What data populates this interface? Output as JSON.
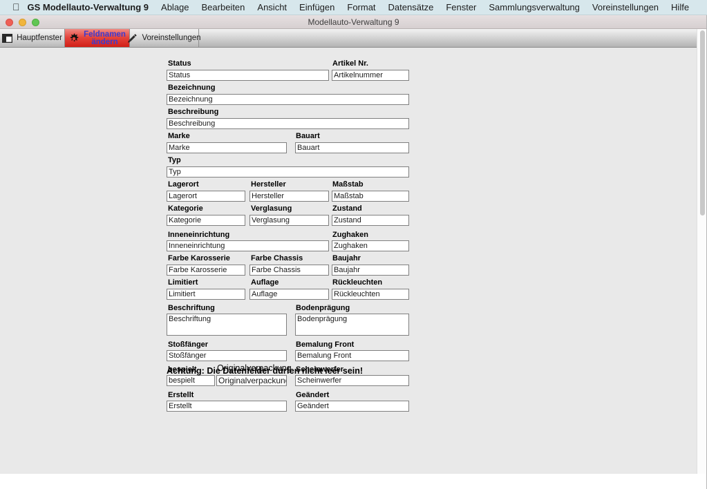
{
  "menubar": {
    "apple_icon": "apple-logo-icon",
    "app_name": "GS Modellauto-Verwaltung 9",
    "items": [
      {
        "label": "Ablage"
      },
      {
        "label": "Bearbeiten"
      },
      {
        "label": "Ansicht"
      },
      {
        "label": "Einfügen"
      },
      {
        "label": "Format"
      },
      {
        "label": "Datensätze"
      },
      {
        "label": "Fenster"
      },
      {
        "label": "Sammlungsverwaltung"
      },
      {
        "label": "Voreinstellungen"
      },
      {
        "label": "Hilfe"
      }
    ]
  },
  "window": {
    "title": "Modellauto-Verwaltung 9",
    "traffic_lights": {
      "close": "#ef5f56",
      "minimize": "#f1b53d",
      "zoom": "#61c654"
    }
  },
  "toolbar": {
    "tabs": [
      {
        "label": "Hauptfenster",
        "icon": "window-layout-icon",
        "active": false
      },
      {
        "label_line1": "Feldnamen",
        "label_line2": "ändern",
        "icon": "gear-icon",
        "active": true,
        "active_bg": "#e4443c",
        "active_text": "#3b3bcf"
      },
      {
        "label": "Voreinstellungen",
        "icon": "pencil-icon",
        "active": false
      }
    ]
  },
  "form": {
    "rows": [
      {
        "fields": [
          {
            "label": "Status",
            "value": "Status"
          },
          {
            "label": "Artikel Nr.",
            "value": "Artikelnummer"
          }
        ]
      },
      {
        "fields": [
          {
            "label": "Bezeichnung",
            "value": "Bezeichnung"
          }
        ]
      },
      {
        "fields": [
          {
            "label": "Beschreibung",
            "value": "Beschreibung"
          }
        ]
      },
      {
        "fields": [
          {
            "label": "Marke",
            "value": "Marke"
          },
          {
            "label": "Bauart",
            "value": "Bauart"
          }
        ]
      },
      {
        "fields": [
          {
            "label": "Typ",
            "value": "Typ"
          }
        ]
      },
      {
        "fields": [
          {
            "label": "Lagerort",
            "value": "Lagerort"
          },
          {
            "label": "Hersteller",
            "value": "Hersteller"
          },
          {
            "label": "Maßstab",
            "value": "Maßstab"
          }
        ]
      },
      {
        "fields": [
          {
            "label": "Kategorie",
            "value": "Kategorie"
          },
          {
            "label": "Verglasung",
            "value": "Verglasung"
          },
          {
            "label": "Zustand",
            "value": "Zustand"
          }
        ]
      },
      {
        "fields": [
          {
            "label": "Inneneinrichtung",
            "value": "Inneneinrichtung"
          },
          {
            "label": "Zughaken",
            "value": "Zughaken"
          }
        ]
      },
      {
        "fields": [
          {
            "label": "Farbe Karosserie",
            "value": "Farbe Karosserie"
          },
          {
            "label": "Farbe Chassis",
            "value": "Farbe Chassis"
          },
          {
            "label": "Baujahr",
            "value": "Baujahr"
          }
        ]
      },
      {
        "fields": [
          {
            "label": "Limitiert",
            "value": "Limitiert"
          },
          {
            "label": "Auflage",
            "value": "Auflage"
          },
          {
            "label": "Rückleuchten",
            "value": "Rückleuchten"
          }
        ]
      },
      {
        "fields": [
          {
            "label": "Beschriftung",
            "value": "Beschriftung"
          },
          {
            "label": "Bodenprägung",
            "value": "Bodenprägung"
          }
        ]
      },
      {
        "fields": [
          {
            "label": "Stoßfänger",
            "value": "Stoßfänger"
          },
          {
            "label": "Bemalung Front",
            "value": "Bemalung Front"
          }
        ]
      },
      {
        "fields": [
          {
            "label": "bespielt",
            "value": "bespielt"
          },
          {
            "label": "Originalverpackung",
            "value": "Originalverpackung"
          },
          {
            "label": "Scheinwerfer",
            "value": "Scheinwerfer"
          }
        ]
      },
      {
        "fields": [
          {
            "label": "Erstellt",
            "value": "Erstellt"
          },
          {
            "label": "Geändert",
            "value": "Geändert"
          }
        ]
      }
    ],
    "warning": "Achtung: Die Datenfelder dürfen nicht leer sein!"
  }
}
